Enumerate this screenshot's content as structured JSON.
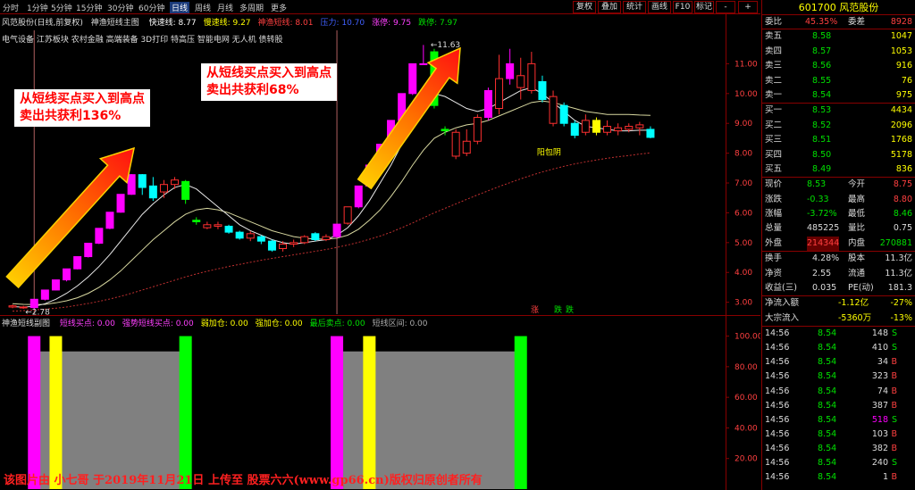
{
  "toolbar": {
    "periods": [
      "分时",
      "1分钟",
      "5分钟",
      "15分钟",
      "30分钟",
      "60分钟",
      "日线",
      "周线",
      "月线",
      "多周期",
      "更多"
    ],
    "active_period": "日线",
    "right_buttons": [
      "复权",
      "叠加",
      "统计",
      "画线",
      "F10",
      "标记",
      "-",
      "+"
    ]
  },
  "main_header": {
    "stock_title": "风范股份(日线,前复权)",
    "indicator_name": "神渔短线主图",
    "items": [
      {
        "label": "快速线: 8.77",
        "color": "#ffffff"
      },
      {
        "label": "慢速线: 9.27",
        "color": "#ffff00"
      },
      {
        "label": "神渔短线: 8.01",
        "color": "#ff4040"
      },
      {
        "label": "压力: 10.70",
        "color": "#4060ff"
      },
      {
        "label": "涨停: 9.75",
        "color": "#ff40ff"
      },
      {
        "label": "跌停: 7.97",
        "color": "#00e000"
      }
    ],
    "sectors": "电气设备  江苏板块  农村金融  高端装备  3D打印  特高压  智能电网  无人机  债转股"
  },
  "chart_data": {
    "type": "candlestick",
    "y_ticks": [
      "11.00",
      "10.00",
      "9.00",
      "8.00",
      "7.00",
      "6.00",
      "5.00",
      "4.00",
      "3.00"
    ],
    "ylim": [
      2.6,
      12.0
    ],
    "candles": [
      {
        "o": 2.88,
        "c": 2.84,
        "h": 2.92,
        "l": 2.8,
        "color": "red"
      },
      {
        "o": 2.84,
        "c": 2.82,
        "h": 2.88,
        "l": 2.78,
        "color": "red"
      },
      {
        "o": 2.82,
        "c": 3.1,
        "h": 3.1,
        "l": 2.78,
        "color": "magenta"
      },
      {
        "o": 3.1,
        "c": 3.41,
        "h": 3.41,
        "l": 3.06,
        "color": "magenta"
      },
      {
        "o": 3.41,
        "c": 3.75,
        "h": 3.75,
        "l": 3.4,
        "color": "magenta"
      },
      {
        "o": 3.75,
        "c": 4.12,
        "h": 4.12,
        "l": 3.7,
        "color": "magenta"
      },
      {
        "o": 4.12,
        "c": 4.53,
        "h": 4.53,
        "l": 4.1,
        "color": "magenta"
      },
      {
        "o": 4.53,
        "c": 4.98,
        "h": 4.98,
        "l": 4.5,
        "color": "magenta"
      },
      {
        "o": 4.98,
        "c": 5.48,
        "h": 5.48,
        "l": 4.95,
        "color": "magenta"
      },
      {
        "o": 5.48,
        "c": 6.02,
        "h": 6.02,
        "l": 5.45,
        "color": "magenta"
      },
      {
        "o": 6.02,
        "c": 6.62,
        "h": 6.62,
        "l": 6.0,
        "color": "magenta"
      },
      {
        "o": 6.62,
        "c": 7.28,
        "h": 7.3,
        "l": 6.6,
        "color": "magenta"
      },
      {
        "o": 7.28,
        "c": 6.85,
        "h": 7.3,
        "l": 6.6,
        "color": "cyan"
      },
      {
        "o": 6.9,
        "c": 6.5,
        "h": 7.2,
        "l": 6.4,
        "color": "cyan"
      },
      {
        "o": 6.7,
        "c": 6.95,
        "h": 7.1,
        "l": 6.5,
        "color": "red"
      },
      {
        "o": 6.95,
        "c": 7.1,
        "h": 7.2,
        "l": 6.8,
        "color": "red"
      },
      {
        "o": 7.05,
        "c": 6.45,
        "h": 7.1,
        "l": 6.3,
        "color": "green"
      },
      {
        "o": 5.75,
        "c": 5.7,
        "h": 5.85,
        "l": 5.6,
        "color": "green"
      },
      {
        "o": 5.6,
        "c": 5.5,
        "h": 5.7,
        "l": 5.45,
        "color": "red"
      },
      {
        "o": 5.6,
        "c": 5.55,
        "h": 5.7,
        "l": 5.45,
        "color": "red"
      },
      {
        "o": 5.55,
        "c": 5.35,
        "h": 5.6,
        "l": 5.3,
        "color": "cyan"
      },
      {
        "o": 5.35,
        "c": 5.15,
        "h": 5.4,
        "l": 5.1,
        "color": "cyan"
      },
      {
        "o": 5.15,
        "c": 5.3,
        "h": 5.38,
        "l": 5.05,
        "color": "red"
      },
      {
        "o": 5.2,
        "c": 5.05,
        "h": 5.25,
        "l": 4.95,
        "color": "cyan"
      },
      {
        "o": 5.05,
        "c": 4.75,
        "h": 5.1,
        "l": 4.7,
        "color": "cyan"
      },
      {
        "o": 4.8,
        "c": 4.95,
        "h": 5.05,
        "l": 4.7,
        "color": "red"
      },
      {
        "o": 4.95,
        "c": 5.0,
        "h": 5.1,
        "l": 4.85,
        "color": "red"
      },
      {
        "o": 5.0,
        "c": 5.2,
        "h": 5.25,
        "l": 4.95,
        "color": "red"
      },
      {
        "o": 5.3,
        "c": 5.1,
        "h": 5.35,
        "l": 5.05,
        "color": "cyan"
      },
      {
        "o": 5.1,
        "c": 5.2,
        "h": 5.28,
        "l": 5.05,
        "color": "red"
      },
      {
        "o": 5.2,
        "c": 5.62,
        "h": 5.62,
        "l": 5.15,
        "color": "magenta"
      },
      {
        "o": 5.65,
        "c": 6.2,
        "h": 6.2,
        "l": 5.6,
        "color": "red"
      },
      {
        "o": 6.2,
        "c": 6.9,
        "h": 6.9,
        "l": 6.15,
        "color": "magenta"
      },
      {
        "o": 6.9,
        "c": 7.6,
        "h": 7.6,
        "l": 6.85,
        "color": "magenta"
      },
      {
        "o": 7.6,
        "c": 8.3,
        "h": 8.3,
        "l": 7.55,
        "color": "magenta"
      },
      {
        "o": 8.3,
        "c": 9.1,
        "h": 9.1,
        "l": 8.25,
        "color": "magenta"
      },
      {
        "o": 9.1,
        "c": 10.0,
        "h": 10.0,
        "l": 9.05,
        "color": "magenta"
      },
      {
        "o": 10.0,
        "c": 11.0,
        "h": 11.0,
        "l": 9.95,
        "color": "magenta"
      },
      {
        "o": 11.0,
        "c": 11.0,
        "h": 11.63,
        "l": 11.0,
        "color": "magenta"
      },
      {
        "o": 11.4,
        "c": 9.6,
        "h": 11.5,
        "l": 9.5,
        "color": "green"
      },
      {
        "o": 8.8,
        "c": 8.75,
        "h": 8.9,
        "l": 8.6,
        "color": "green"
      },
      {
        "o": 8.7,
        "c": 7.9,
        "h": 8.8,
        "l": 7.8,
        "color": "red"
      },
      {
        "o": 8.0,
        "c": 8.4,
        "h": 8.8,
        "l": 7.9,
        "color": "red"
      },
      {
        "o": 8.4,
        "c": 9.2,
        "h": 9.3,
        "l": 8.3,
        "color": "red"
      },
      {
        "o": 9.2,
        "c": 10.1,
        "h": 10.2,
        "l": 9.1,
        "color": "magenta"
      },
      {
        "o": 9.5,
        "c": 10.5,
        "h": 11.3,
        "l": 9.3,
        "color": "red"
      },
      {
        "o": 10.5,
        "c": 11.0,
        "h": 11.5,
        "l": 10.3,
        "color": "magenta"
      },
      {
        "o": 10.6,
        "c": 10.2,
        "h": 11.2,
        "l": 9.8,
        "color": "red"
      },
      {
        "o": 10.1,
        "c": 11.0,
        "h": 11.4,
        "l": 10.0,
        "color": "red"
      },
      {
        "o": 10.4,
        "c": 9.8,
        "h": 10.6,
        "l": 9.7,
        "color": "cyan"
      },
      {
        "o": 9.9,
        "c": 9.0,
        "h": 10.1,
        "l": 8.9,
        "color": "red"
      },
      {
        "o": 9.6,
        "c": 9.0,
        "h": 9.7,
        "l": 8.9,
        "color": "cyan"
      },
      {
        "o": 9.0,
        "c": 8.6,
        "h": 9.1,
        "l": 8.5,
        "color": "cyan"
      },
      {
        "o": 8.7,
        "c": 9.1,
        "h": 9.3,
        "l": 8.6,
        "color": "red"
      },
      {
        "o": 8.7,
        "c": 9.1,
        "h": 9.2,
        "l": 8.6,
        "color": "yellow"
      },
      {
        "o": 8.9,
        "c": 8.7,
        "h": 9.1,
        "l": 8.6,
        "color": "red"
      },
      {
        "o": 8.75,
        "c": 8.85,
        "h": 9.0,
        "l": 8.6,
        "color": "red"
      },
      {
        "o": 8.8,
        "c": 8.9,
        "h": 9.0,
        "l": 8.7,
        "color": "red"
      },
      {
        "o": 8.95,
        "c": 8.85,
        "h": 9.05,
        "l": 8.6,
        "color": "red"
      },
      {
        "o": 8.8,
        "c": 8.53,
        "h": 8.9,
        "l": 8.5,
        "color": "cyan"
      }
    ],
    "fast_line": [
      2.85,
      2.84,
      2.86,
      2.95,
      3.1,
      3.3,
      3.55,
      3.85,
      4.2,
      4.6,
      5.05,
      5.5,
      5.95,
      6.3,
      6.6,
      6.85,
      6.95,
      6.8,
      6.5,
      6.2,
      5.9,
      5.6,
      5.4,
      5.25,
      5.1,
      5.0,
      4.95,
      5.0,
      5.05,
      5.1,
      5.25,
      5.5,
      5.9,
      6.4,
      7.0,
      7.6,
      8.3,
      9.1,
      9.8,
      10.0,
      9.9,
      9.7,
      9.5,
      9.4,
      9.5,
      9.7,
      9.9,
      10.1,
      10.2,
      10.0,
      9.7,
      9.4,
      9.1,
      8.9,
      8.85,
      8.8,
      8.75,
      8.75,
      8.77,
      8.77
    ],
    "slow_line": [
      2.95,
      2.93,
      2.92,
      2.93,
      2.98,
      3.05,
      3.15,
      3.3,
      3.5,
      3.75,
      4.05,
      4.4,
      4.75,
      5.1,
      5.4,
      5.7,
      5.95,
      6.1,
      6.15,
      6.1,
      6.0,
      5.85,
      5.7,
      5.55,
      5.4,
      5.3,
      5.2,
      5.15,
      5.12,
      5.12,
      5.15,
      5.25,
      5.45,
      5.75,
      6.1,
      6.55,
      7.05,
      7.6,
      8.1,
      8.5,
      8.7,
      8.85,
      8.95,
      9.0,
      9.1,
      9.25,
      9.4,
      9.55,
      9.7,
      9.75,
      9.7,
      9.6,
      9.5,
      9.4,
      9.35,
      9.3,
      9.3,
      9.3,
      9.28,
      9.27
    ],
    "dotted_line": [
      2.7,
      2.72,
      2.74,
      2.77,
      2.8,
      2.84,
      2.9,
      2.96,
      3.03,
      3.11,
      3.2,
      3.3,
      3.41,
      3.52,
      3.63,
      3.74,
      3.85,
      3.95,
      4.04,
      4.12,
      4.2,
      4.27,
      4.34,
      4.41,
      4.47,
      4.53,
      4.59,
      4.65,
      4.71,
      4.77,
      4.84,
      4.92,
      5.01,
      5.11,
      5.22,
      5.35,
      5.5,
      5.66,
      5.83,
      6.0,
      6.15,
      6.3,
      6.45,
      6.6,
      6.74,
      6.88,
      7.01,
      7.14,
      7.26,
      7.37,
      7.47,
      7.56,
      7.64,
      7.71,
      7.77,
      7.83,
      7.88,
      7.92,
      7.97,
      8.01
    ],
    "labels": {
      "high_label": "11.63",
      "low_label": "2.78",
      "zhang": "涨",
      "die": "跌",
      "zhang2": "跌",
      "yang_bao_yin": "阳包阴"
    }
  },
  "callouts": [
    {
      "line1": "从短线买点买入到高点",
      "line2": "卖出共获利136%"
    },
    {
      "line1": "从短线买点买入到高点",
      "line2": "卖出共获利68%"
    }
  ],
  "indicator": {
    "title": "神渔短线副图",
    "items": [
      {
        "label": "短线买点: 0.00",
        "color": "#ff40ff"
      },
      {
        "label": "强势短线买点: 0.00",
        "color": "#ff40ff"
      },
      {
        "label": "弱加仓: 0.00",
        "color": "#ffff00"
      },
      {
        "label": "强加仓: 0.00",
        "color": "#ffff00"
      },
      {
        "label": "最后卖点: 0.00",
        "color": "#00e000"
      },
      {
        "label": "短线区间: 0.00",
        "color": "#aaaaaa"
      }
    ],
    "y_ticks": [
      "100.00",
      "80.00",
      "60.00",
      "40.00",
      "20.00"
    ],
    "bars": [
      {
        "candle": 2,
        "color": "#ff00ff"
      },
      {
        "candle": 4,
        "color": "#ffff00"
      },
      {
        "candle": 16,
        "color": "#00ff00"
      },
      {
        "candle": 30,
        "color": "#ff00ff"
      },
      {
        "candle": 33,
        "color": "#ffff00"
      },
      {
        "candle": 47,
        "color": "#00ff00"
      }
    ],
    "zones": [
      [
        2,
        16
      ],
      [
        30,
        47
      ]
    ],
    "zone_level": 90
  },
  "quote_panel": {
    "code_name": "601700 风范股份",
    "ratio": {
      "label1": "委比",
      "value1": "45.35%",
      "label2": "委差",
      "value2": "8928"
    },
    "asks": [
      {
        "label": "卖五",
        "price": "8.58",
        "vol": "1047"
      },
      {
        "label": "卖四",
        "price": "8.57",
        "vol": "1053"
      },
      {
        "label": "卖三",
        "price": "8.56",
        "vol": "916"
      },
      {
        "label": "卖二",
        "price": "8.55",
        "vol": "76"
      },
      {
        "label": "卖一",
        "price": "8.54",
        "vol": "975"
      }
    ],
    "bids": [
      {
        "label": "买一",
        "price": "8.53",
        "vol": "4434"
      },
      {
        "label": "买二",
        "price": "8.52",
        "vol": "2096"
      },
      {
        "label": "买三",
        "price": "8.51",
        "vol": "1768"
      },
      {
        "label": "买四",
        "price": "8.50",
        "vol": "5178"
      },
      {
        "label": "买五",
        "price": "8.49",
        "vol": "836"
      }
    ],
    "stats": [
      {
        "l1": "现价",
        "v1": "8.53",
        "l2": "今开",
        "v2": "8.75",
        "c1": "grn",
        "c2": "red"
      },
      {
        "l1": "涨跌",
        "v1": "-0.33",
        "l2": "最高",
        "v2": "8.80",
        "c1": "grn",
        "c2": "red"
      },
      {
        "l1": "涨幅",
        "v1": "-3.72%",
        "l2": "最低",
        "v2": "8.46",
        "c1": "grn",
        "c2": "grn"
      },
      {
        "l1": "总量",
        "v1": "485225",
        "l2": "量比",
        "v2": "0.75",
        "c1": "wht",
        "c2": "wht"
      },
      {
        "l1": "外盘",
        "v1": "214344",
        "l2": "内盘",
        "v2": "270881",
        "c1": "red",
        "c2": "grn"
      }
    ],
    "stats2": [
      {
        "l1": "换手",
        "v1": "4.28%",
        "l2": "股本",
        "v2": "11.3亿"
      },
      {
        "l1": "净资",
        "v1": "2.55",
        "l2": "流通",
        "v2": "11.3亿"
      },
      {
        "l1": "收益(三)",
        "v1": "0.035",
        "l2": "PE(动)",
        "v2": "181.3"
      }
    ],
    "flow": [
      {
        "label": "净流入额",
        "v1": "-1.12亿",
        "v2": "-27%"
      },
      {
        "label": "大宗流入",
        "v1": "-5360万",
        "v2": "-13%"
      }
    ],
    "ticks": [
      {
        "time": "14:56",
        "price": "8.54",
        "vol": "148",
        "dir": "S"
      },
      {
        "time": "14:56",
        "price": "8.54",
        "vol": "410",
        "dir": "S"
      },
      {
        "time": "14:56",
        "price": "8.54",
        "vol": "34",
        "dir": "B"
      },
      {
        "time": "14:56",
        "price": "8.54",
        "vol": "323",
        "dir": "B"
      },
      {
        "time": "14:56",
        "price": "8.54",
        "vol": "74",
        "dir": "B"
      },
      {
        "time": "14:56",
        "price": "8.54",
        "vol": "387",
        "dir": "B"
      },
      {
        "time": "14:56",
        "price": "8.54",
        "vol": "518",
        "dir": "S"
      },
      {
        "time": "14:56",
        "price": "8.54",
        "vol": "103",
        "dir": "B"
      },
      {
        "time": "14:56",
        "price": "8.54",
        "vol": "382",
        "dir": "B"
      },
      {
        "time": "14:56",
        "price": "8.54",
        "vol": "240",
        "dir": "S"
      },
      {
        "time": "14:56",
        "price": "8.54",
        "vol": "1",
        "dir": "B"
      }
    ]
  },
  "watermark": "该图片由 小七哥 于2019年11月21日 上传至 股票六六(www.gp66.cn)版权归原创者所有"
}
